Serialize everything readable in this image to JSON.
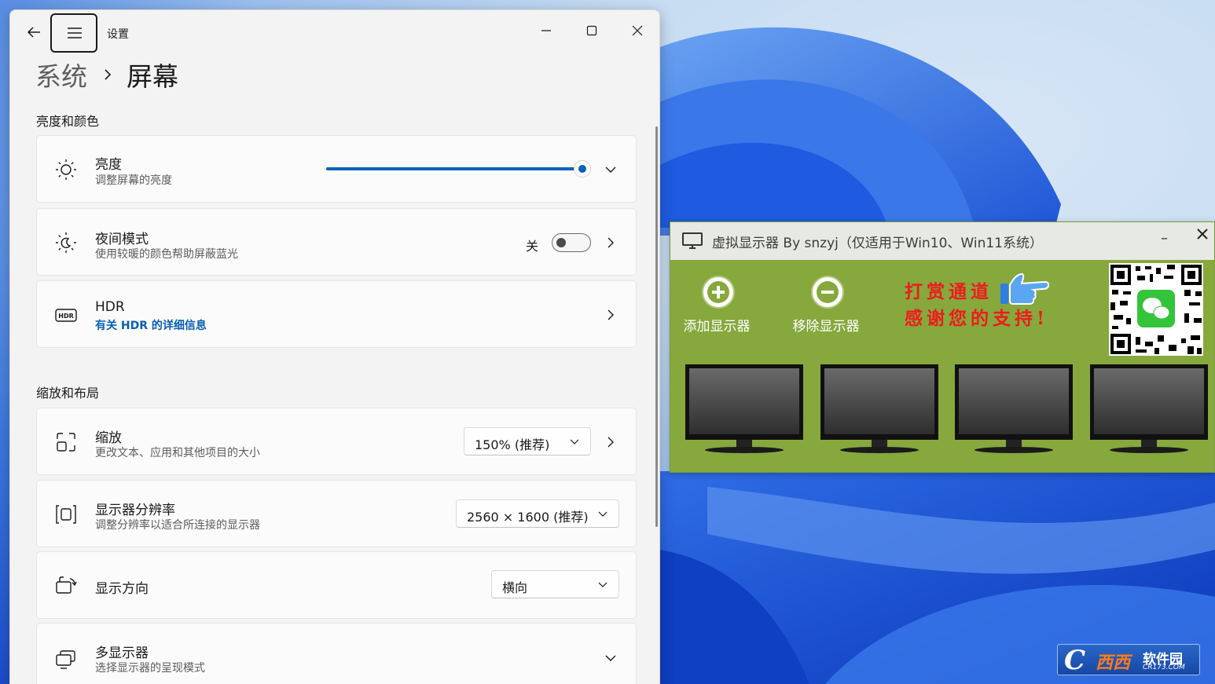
{
  "settings": {
    "app_title": "设置",
    "breadcrumb": {
      "parent": "系统",
      "current": "屏幕"
    },
    "sections": {
      "brightness_color": "亮度和颜色",
      "scale_layout": "缩放和布局"
    },
    "brightness": {
      "label": "亮度",
      "sub": "调整屏幕的亮度",
      "level_percent": 100
    },
    "night_light": {
      "label": "夜间模式",
      "sub": "使用较暖的颜色帮助屏蔽蓝光",
      "toggle_label": "关",
      "on": false
    },
    "hdr": {
      "label": "HDR",
      "link": "有关 HDR 的详细信息"
    },
    "scale": {
      "label": "缩放",
      "sub": "更改文本、应用和其他项目的大小",
      "value": "150% (推荐)"
    },
    "resolution": {
      "label": "显示器分辨率",
      "sub": "调整分辨率以适合所连接的显示器",
      "value": "2560 × 1600 (推荐)"
    },
    "orientation": {
      "label": "显示方向",
      "value": "横向"
    },
    "multi_display": {
      "label": "多显示器",
      "sub": "选择显示器的呈现模式"
    },
    "accent_color": "#0b62b8"
  },
  "virtual_display": {
    "title": "虚拟显示器 By snzyj（仅适用于Win10、Win11系统）",
    "add_label": "添加显示器",
    "remove_label": "移除显示器",
    "donate_line1": "打赏通道",
    "donate_line2": "感谢您的支持!",
    "minimize_label": "–",
    "monitor_count": 4,
    "background_color": "#86a83d"
  },
  "watermark": {
    "letter": "C",
    "main": "西西",
    "soft": "软件园",
    "url": "CR173.COM"
  }
}
